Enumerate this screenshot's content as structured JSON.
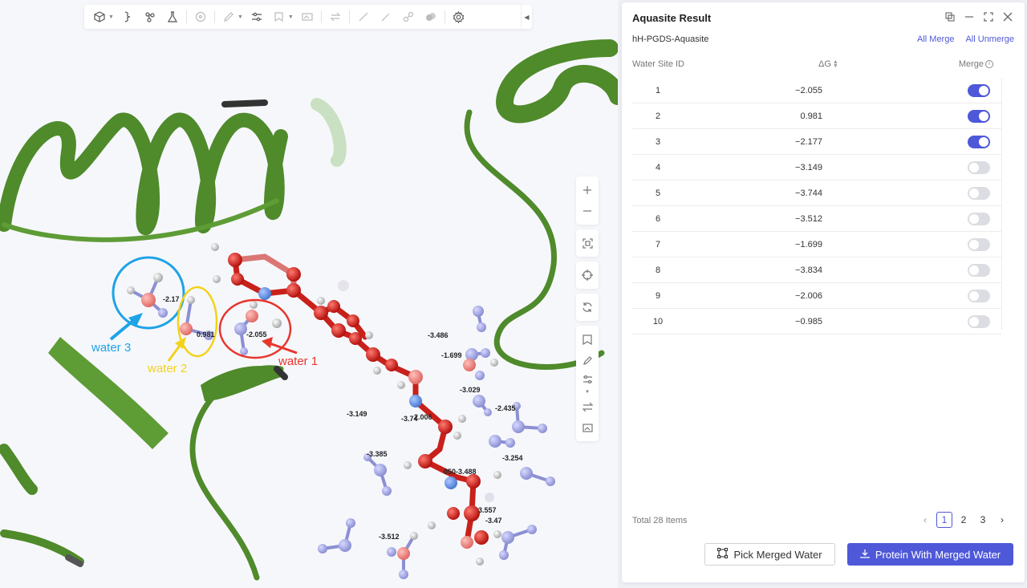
{
  "panel": {
    "title": "Aquasite Result",
    "project_name": "hH-PGDS-Aquasite",
    "all_merge": "All Merge",
    "all_unmerge": "All Unmerge",
    "columns": {
      "id": "Water Site ID",
      "dg": "ΔG",
      "merge": "Merge"
    },
    "rows": [
      {
        "id": "1",
        "dg": "−2.055",
        "merged": true
      },
      {
        "id": "2",
        "dg": "0.981",
        "merged": true
      },
      {
        "id": "3",
        "dg": "−2.177",
        "merged": true
      },
      {
        "id": "4",
        "dg": "−3.149",
        "merged": false
      },
      {
        "id": "5",
        "dg": "−3.744",
        "merged": false
      },
      {
        "id": "6",
        "dg": "−3.512",
        "merged": false
      },
      {
        "id": "7",
        "dg": "−1.699",
        "merged": false
      },
      {
        "id": "8",
        "dg": "−3.834",
        "merged": false
      },
      {
        "id": "9",
        "dg": "−2.006",
        "merged": false
      },
      {
        "id": "10",
        "dg": "−0.985",
        "merged": false
      }
    ],
    "total": "Total 28 Items",
    "pages": [
      "1",
      "2",
      "3"
    ],
    "current_page": "1",
    "pick_button": "Pick Merged Water",
    "protein_button": "Protein With Merged Water"
  },
  "viewer": {
    "water_labels": {
      "w1": "water 1",
      "w2": "water 2",
      "w3": "water 3"
    },
    "value_labels": {
      "v1": "-2.17",
      "v2": "0.981",
      "v3": "-2.055",
      "v4": "-3.486",
      "v5": "-1.699",
      "v6": "-3.029",
      "v7": "-2.435",
      "v8": "-3.149",
      "v9": "-3.74",
      "v10": "2.006",
      "v11": "-3.385",
      "v12": "-3.254",
      "v13": "050-3.488",
      "v14": "3.557",
      "v15": "-3.47",
      "v16": "-3.512"
    },
    "colors": {
      "water1": "#e8352c",
      "water2": "#f2d21b",
      "water3": "#1ea3e6",
      "accent": "#4e58d9",
      "ribbon": "#4f8a2b"
    }
  }
}
